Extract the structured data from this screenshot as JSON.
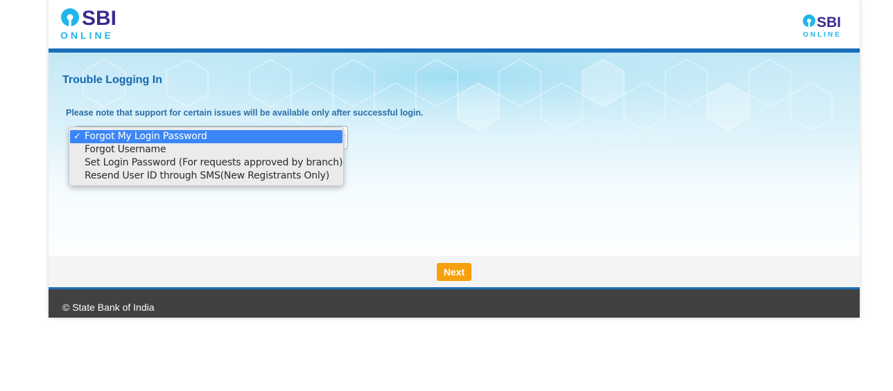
{
  "header": {
    "logo_left": {
      "word": "SBI",
      "sub": "ONLINE"
    },
    "logo_right": {
      "word": "SBI",
      "sub": "ONLINE"
    }
  },
  "main": {
    "title": "Trouble Logging In",
    "note": "Please note that support for certain issues will be available only after successful login.",
    "issue_select": {
      "selected_value": "Forgot My Login Password",
      "check_mark": "✓",
      "options": [
        "Forgot My Login Password",
        "Forgot Username",
        "Set Login Password (For requests approved by branch)",
        "Resend User ID through SMS(New Registrants Only)"
      ]
    }
  },
  "actions": {
    "next_label": "Next"
  },
  "footer": {
    "copyright": "© State Bank of India"
  },
  "colors": {
    "brand_blue": "#1a6fba",
    "logo_cyan": "#1fb6ea",
    "logo_purple": "#3b2a8f",
    "next_button": "#f5a10e",
    "footer_bg": "#414141",
    "title_blue": "#1467b0"
  },
  "icons": {
    "logo_mark": "sbi-keyhole-logo-icon",
    "dropdown_arrow": "chevron-down-icon",
    "check": "checkmark-icon"
  }
}
